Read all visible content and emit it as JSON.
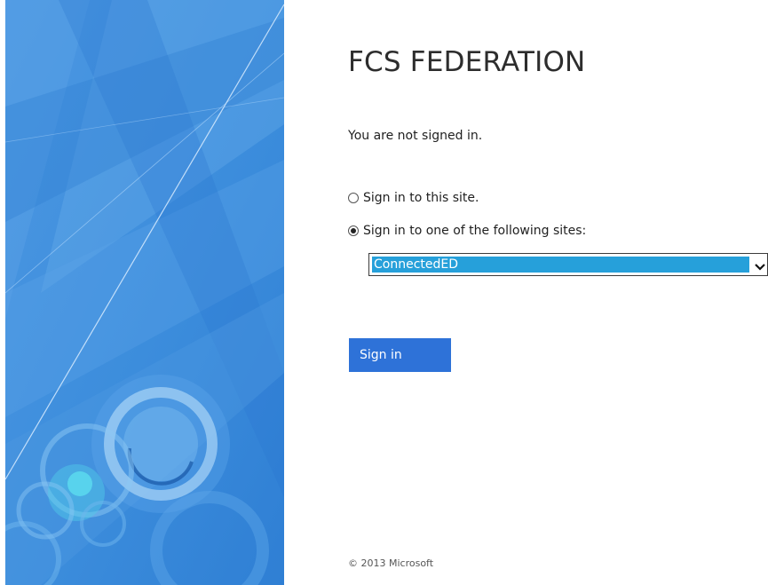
{
  "page": {
    "title": "FCS FEDERATION",
    "status_message": "You are not signed in."
  },
  "signin_options": [
    {
      "label": "Sign in to this site.",
      "selected": false
    },
    {
      "label": "Sign in to one of the following sites:",
      "selected": true
    }
  ],
  "site_select": {
    "selected": "ConnectedED"
  },
  "signin_button": {
    "label": "Sign in"
  },
  "footer": {
    "copyright": "© 2013 Microsoft"
  },
  "colors": {
    "illustration_blue": "#3f8fdd",
    "button_blue": "#2e72d8",
    "selection_blue": "#26a0da"
  }
}
